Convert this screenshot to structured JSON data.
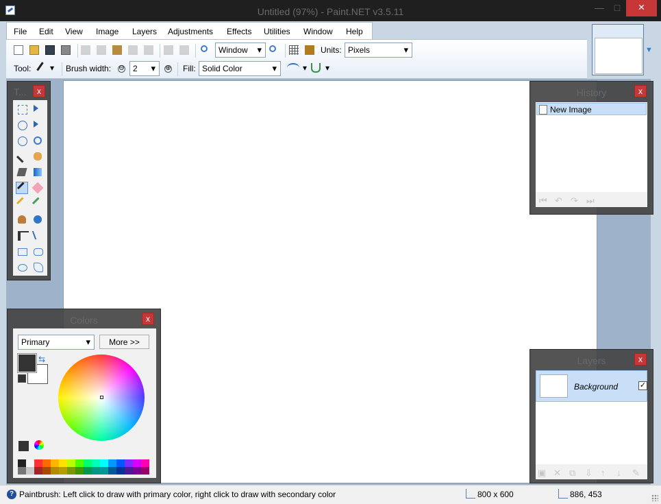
{
  "window": {
    "title": "Untitled (97%) - Paint.NET v3.5.11",
    "minimize": "—",
    "maximize": "□",
    "close": "×"
  },
  "menu": [
    "File",
    "Edit",
    "View",
    "Image",
    "Layers",
    "Adjustments",
    "Effects",
    "Utilities",
    "Window",
    "Help"
  ],
  "toolbar": {
    "zoom_value": "Window",
    "units_label": "Units:",
    "units_value": "Pixels",
    "tool_label": "Tool:",
    "tool_dropdown": "▾",
    "brush_width_label": "Brush width:",
    "brush_width_value": "2",
    "fill_label": "Fill:",
    "fill_value": "Solid Color",
    "antialias_dropdown": "▾",
    "blend_dropdown": "▾",
    "minus": "⊖",
    "plus": "⊕"
  },
  "panels": {
    "tools_title": "T...",
    "history_title": "History",
    "colors_title": "Colors",
    "layers_title": "Layers",
    "close": "x"
  },
  "history": {
    "items": [
      "New Image"
    ],
    "controls": [
      "⏮",
      "↶",
      "↷",
      "⏭"
    ]
  },
  "colors": {
    "mode": "Primary",
    "more": "More >>",
    "primary": "#333333",
    "secondary": "#ffffff",
    "palette_top": [
      "#222222",
      "#f5f5f5",
      "#ff3333",
      "#ff6a00",
      "#ffb400",
      "#ffe100",
      "#b8ff00",
      "#4dff00",
      "#00ff73",
      "#00ffb7",
      "#00ffff",
      "#0099ff",
      "#0057ff",
      "#7b2cff",
      "#d900ff",
      "#ff00b0"
    ],
    "palette_bottom": [
      "#777777",
      "#c8c8c8",
      "#a62424",
      "#a84b00",
      "#b58a00",
      "#b2a000",
      "#7a9800",
      "#3f9800",
      "#00984d",
      "#009882",
      "#009898",
      "#005a98",
      "#003498",
      "#4a1a98",
      "#7c0098",
      "#98006a"
    ]
  },
  "layers": {
    "items": [
      {
        "name": "Background",
        "visible": "✓"
      }
    ],
    "controls": [
      "▣",
      "✕",
      "⧉",
      "⇩",
      "↑",
      "↓",
      "✎"
    ]
  },
  "status": {
    "help": "?",
    "message": "Paintbrush: Left click to draw with primary color, right click to draw with secondary color",
    "image_size": "800 x 600",
    "cursor": "886, 453"
  }
}
